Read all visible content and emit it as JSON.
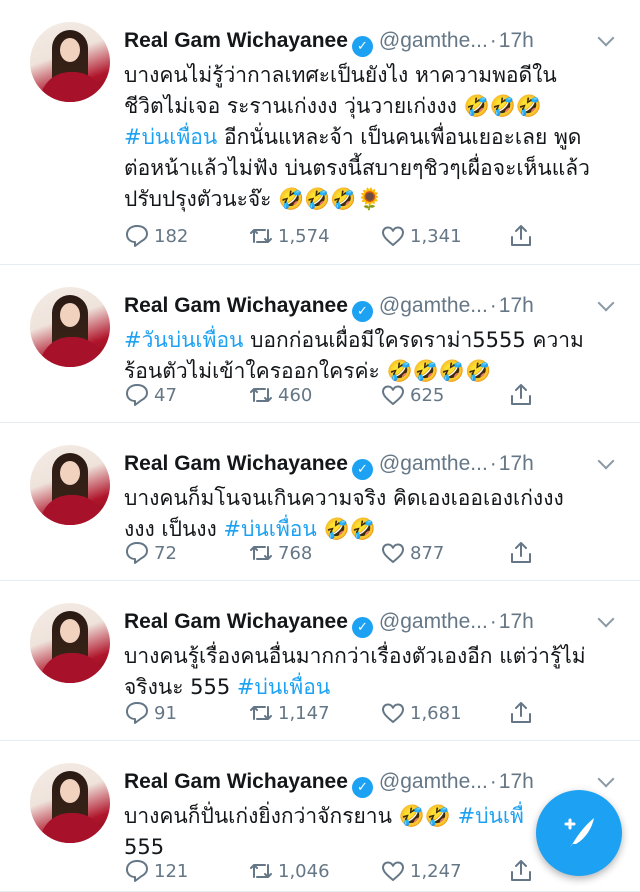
{
  "tweets": [
    {
      "name": "Real Gam Wichayanee",
      "handle": "@gamthe...",
      "separator": "·",
      "time": "17h",
      "lines": [
        [
          {
            "t": "บางคนไม่รู้ว่ากาลเทศะเป็นยังไง หาความพอดีใน"
          }
        ],
        [
          {
            "t": "ชีวิตไม่เจอ ระรานเก่งงง วุ่นวายเก่งงง 🤣🤣🤣"
          }
        ],
        [
          {
            "t": "#บ่นเพื่อน",
            "h": true
          },
          {
            "t": " อีกนั่นแหละจ้า เป็นคนเพื่อนเยอะเลย พูด"
          }
        ],
        [
          {
            "t": "ต่อหน้าแล้วไม่ฟัง บ่นตรงนี้สบายๆชิวๆเผื่อจะเห็นแล้ว"
          }
        ],
        [
          {
            "t": "ปรับปรุงตัวนะจ๊ะ 🤣🤣🤣🌻"
          }
        ]
      ],
      "replies": "182",
      "retweets": "1,574",
      "likes": "1,341"
    },
    {
      "name": "Real Gam Wichayanee",
      "handle": "@gamthe...",
      "separator": "·",
      "time": "17h",
      "lines": [
        [
          {
            "t": "#วันบ่นเพื่อน",
            "h": true
          },
          {
            "t": " บอกก่อนเผื่อมีใครดราม่า5555 ความ"
          }
        ],
        [
          {
            "t": "ร้อนตัวไม่เข้าใครออกใครค่ะ 🤣🤣🤣🤣"
          }
        ]
      ],
      "replies": "47",
      "retweets": "460",
      "likes": "625"
    },
    {
      "name": "Real Gam Wichayanee",
      "handle": "@gamthe...",
      "separator": "·",
      "time": "17h",
      "lines": [
        [
          {
            "t": "บางคนก็มโนจนเกินความจริง คิดเองเออเองเก่งงง"
          }
        ],
        [
          {
            "t": "งงง เป็นงง "
          },
          {
            "t": "#บ่นเพื่อน",
            "h": true
          },
          {
            "t": " 🤣🤣"
          }
        ]
      ],
      "replies": "72",
      "retweets": "768",
      "likes": "877"
    },
    {
      "name": "Real Gam Wichayanee",
      "handle": "@gamthe...",
      "separator": "·",
      "time": "17h",
      "lines": [
        [
          {
            "t": "บางคนรู้เรื่องคนอื่นมากกว่าเรื่องตัวเองอีก แต่ว่ารู้ไม่"
          }
        ],
        [
          {
            "t": "จริงนะ 555 "
          },
          {
            "t": "#บ่นเพื่อน",
            "h": true
          }
        ]
      ],
      "replies": "91",
      "retweets": "1,147",
      "likes": "1,681"
    },
    {
      "name": "Real Gam Wichayanee",
      "handle": "@gamthe...",
      "separator": "·",
      "time": "17h",
      "lines": [
        [
          {
            "t": "บางคนก็ปั่นเก่งยิ่งกว่าจักรยาน 🤣🤣 "
          },
          {
            "t": "#บ่นเพื่",
            "h": true
          }
        ],
        [
          {
            "t": "555"
          }
        ]
      ],
      "replies": "121",
      "retweets": "1,046",
      "likes": "1,247"
    }
  ],
  "colors": {
    "accent": "#1da1f2",
    "text": "#14171a",
    "muted": "#657786",
    "divider": "#e6ecf0"
  },
  "icons": {
    "reply": "reply-icon",
    "retweet": "retweet-icon",
    "like": "heart-icon",
    "share": "share-icon",
    "verified": "verified-badge-icon",
    "compose": "compose-tweet-icon"
  }
}
